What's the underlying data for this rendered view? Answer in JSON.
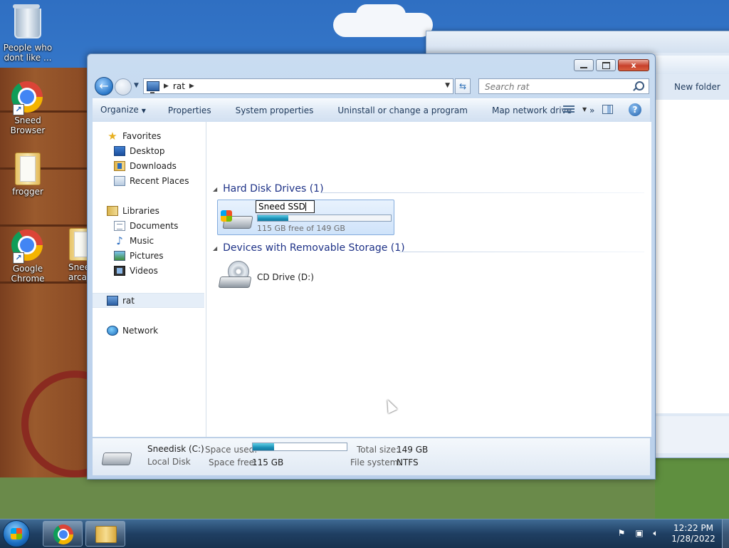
{
  "desktop": {
    "icons": [
      {
        "label": "People who dont like ..."
      },
      {
        "label": "Sneed Browser"
      },
      {
        "label": "frogger"
      },
      {
        "label": "Google Chrome"
      },
      {
        "label": "Snee arcad"
      }
    ]
  },
  "back_window": {
    "new_folder_label": "New folder"
  },
  "window": {
    "caption": {
      "minimize": "–",
      "maximize": "□",
      "close": "x"
    },
    "address": {
      "crumb": "rat"
    },
    "search": {
      "placeholder": "Search rat"
    },
    "commands": {
      "organize": "Organize",
      "properties": "Properties",
      "system_properties": "System properties",
      "uninstall": "Uninstall or change a program",
      "map_network_drive": "Map network drive",
      "more": "»"
    },
    "nav_pane": {
      "favorites": "Favorites",
      "desktop": "Desktop",
      "downloads": "Downloads",
      "recent_places": "Recent Places",
      "libraries": "Libraries",
      "documents": "Documents",
      "music": "Music",
      "pictures": "Pictures",
      "videos": "Videos",
      "computer": "rat",
      "network": "Network"
    },
    "content": {
      "hdd_section": "Hard Disk Drives (1)",
      "removable_section": "Devices with Removable Storage (1)",
      "drive_c": {
        "rename_value": "Sneed SSD",
        "free_text": "115 GB free of 149 GB",
        "used_fraction": 0.23
      },
      "cd_drive": {
        "label": "CD Drive (D:)"
      }
    },
    "details": {
      "name": "Sneedisk (C:)",
      "type": "Local Disk",
      "space_used_label": "Space used:",
      "space_free_label": "Space free:",
      "space_free_value": "115 GB",
      "total_size_label": "Total size:",
      "total_size_value": "149 GB",
      "file_system_label": "File system:",
      "file_system_value": "NTFS"
    }
  },
  "taskbar": {
    "clock_time": "12:22 PM",
    "clock_date": "1/28/2022"
  }
}
